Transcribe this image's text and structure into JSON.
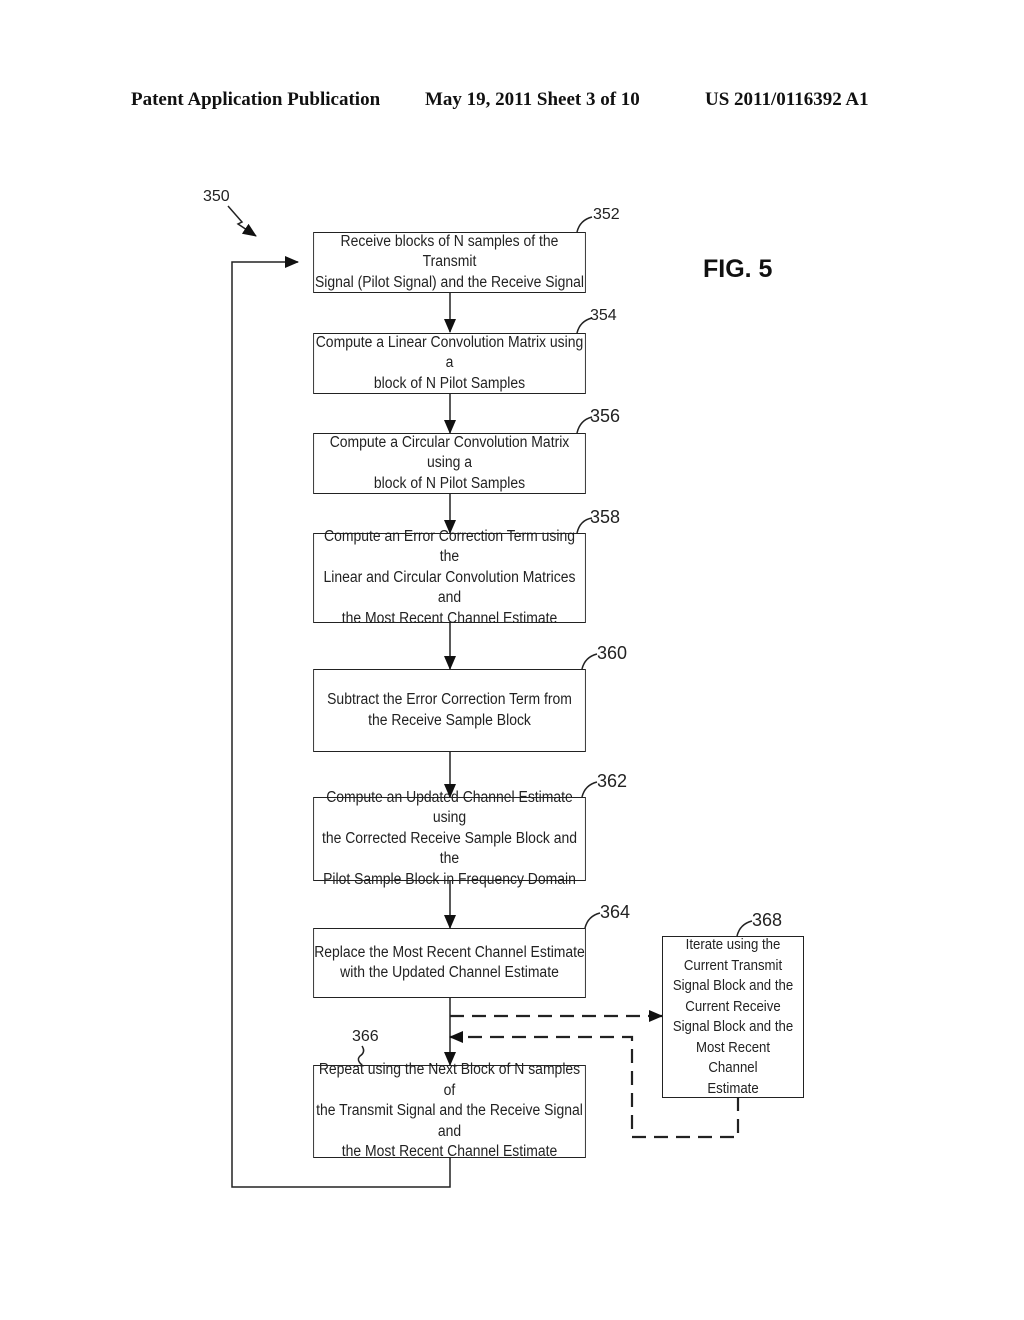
{
  "header": {
    "publication": "Patent Application Publication",
    "date_sheet": "May 19, 2011  Sheet 3 of 10",
    "number": "US 2011/0116392 A1"
  },
  "figure": {
    "label": "FIG. 5",
    "ref": "350"
  },
  "steps": [
    {
      "ref": "352",
      "text": "Receive blocks of N samples of the Transmit Signal (Pilot Signal) and the Receive Signal"
    },
    {
      "ref": "354",
      "text": "Compute a Linear Convolution Matrix using a block of N Pilot Samples"
    },
    {
      "ref": "356",
      "text": "Compute a Circular Convolution Matrix using a block of N Pilot Samples"
    },
    {
      "ref": "358",
      "text": "Compute an Error Correction Term using the Linear and Circular Convolution Matrices and the Most Recent Channel Estimate"
    },
    {
      "ref": "360",
      "text": "Subtract the Error Correction Term from the Receive Sample Block"
    },
    {
      "ref": "362",
      "text": "Compute an Updated Channel Estimate using the Corrected Receive Sample Block and the Pilot Sample Block in Frequency Domain"
    },
    {
      "ref": "364",
      "text": "Replace the Most Recent Channel Estimate with the Updated Channel Estimate"
    },
    {
      "ref": "366",
      "text": "Repeat using the Next Block of N samples of the Transmit Signal and the Receive Signal and the Most Recent Channel Estimate"
    },
    {
      "ref": "368",
      "text": "Iterate using the Current Transmit Signal Block and the Current Receive Signal Block and the Most Recent Channel Estimate"
    }
  ],
  "lines": {
    "352": [
      "Receive blocks of N samples of the Transmit",
      "Signal (Pilot Signal) and the Receive Signal"
    ],
    "354": [
      "Compute a Linear Convolution Matrix using a",
      "block of N Pilot Samples"
    ],
    "356": [
      "Compute a Circular Convolution Matrix using a",
      "block of N Pilot Samples"
    ],
    "358": [
      "Compute an Error Correction Term using the",
      "Linear and Circular Convolution Matrices and",
      "the Most Recent Channel Estimate"
    ],
    "360": [
      "Subtract the Error Correction Term from",
      "the Receive Sample Block"
    ],
    "362": [
      "Compute an Updated Channel Estimate using",
      "the Corrected Receive Sample Block and the",
      "Pilot Sample Block in Frequency Domain"
    ],
    "364": [
      "Replace the Most Recent Channel Estimate",
      "with the Updated Channel Estimate"
    ],
    "366": [
      "Repeat using the Next Block of N samples of",
      "the Transmit Signal and the Receive Signal and",
      "the Most Recent Channel Estimate"
    ],
    "368": [
      "Iterate using the",
      "Current Transmit",
      "Signal Block and the",
      "Current Receive",
      "Signal Block and the",
      "Most Recent Channel",
      "Estimate"
    ]
  }
}
